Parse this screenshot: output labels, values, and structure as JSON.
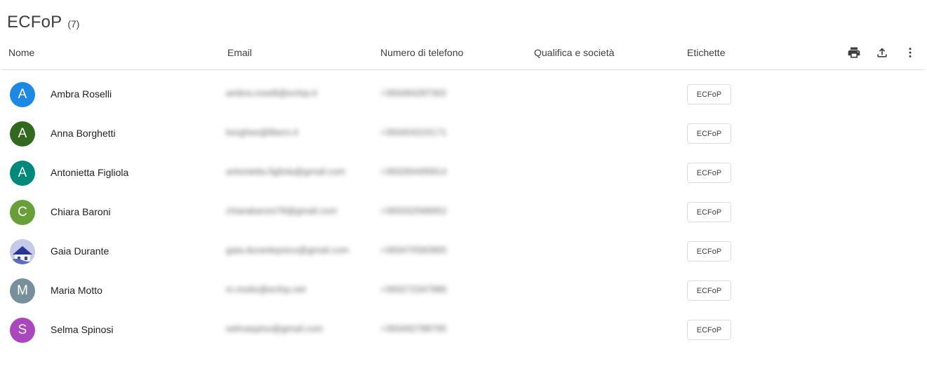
{
  "list": {
    "title": "ECFoP",
    "count": "(7)"
  },
  "columns": {
    "name": "Nome",
    "email": "Email",
    "phone": "Numero di telefono",
    "job": "Qualifica e società",
    "labels": "Etichette"
  },
  "actions": {
    "print_icon": "printer-icon",
    "export_icon": "upload-icon",
    "more_icon": "more-vert-icon"
  },
  "contacts": [
    {
      "initial": "A",
      "name": "Ambra Roselli",
      "email": "ambra.roselli@ecfop.it",
      "phone": "+393484287302",
      "label": "ECFoP",
      "avatar_color": "#1e88e5"
    },
    {
      "initial": "A",
      "name": "Anna Borghetti",
      "email": "borghee@libero.it",
      "phone": "+393404224171",
      "label": "ECFoP",
      "avatar_color": "#33691e"
    },
    {
      "initial": "A",
      "name": "Antonietta Figliola",
      "email": "antonietta.figliola@gmail.com",
      "phone": "+393284495814",
      "label": "ECFoP",
      "avatar_color": "#00897b"
    },
    {
      "initial": "C",
      "name": "Chiara Baroni",
      "email": "chiarabaroni78@gmail.com",
      "phone": "+393332568952",
      "label": "ECFoP",
      "avatar_color": "#689f38"
    },
    {
      "initial": "",
      "name": "Gaia Durante",
      "email": "gaia.durantepsico@gmail.com",
      "phone": "+393470582865",
      "label": "ECFoP",
      "avatar_color": "#c5cae9"
    },
    {
      "initial": "M",
      "name": "Maria Motto",
      "email": "m.motto@ecfop.net",
      "phone": "+393272347986",
      "label": "ECFoP",
      "avatar_color": "#78909c"
    },
    {
      "initial": "S",
      "name": "Selma Spinosi",
      "email": "selmaspino@gmail.com",
      "phone": "+393492788795",
      "label": "ECFoP",
      "avatar_color": "#ab47bc"
    }
  ]
}
